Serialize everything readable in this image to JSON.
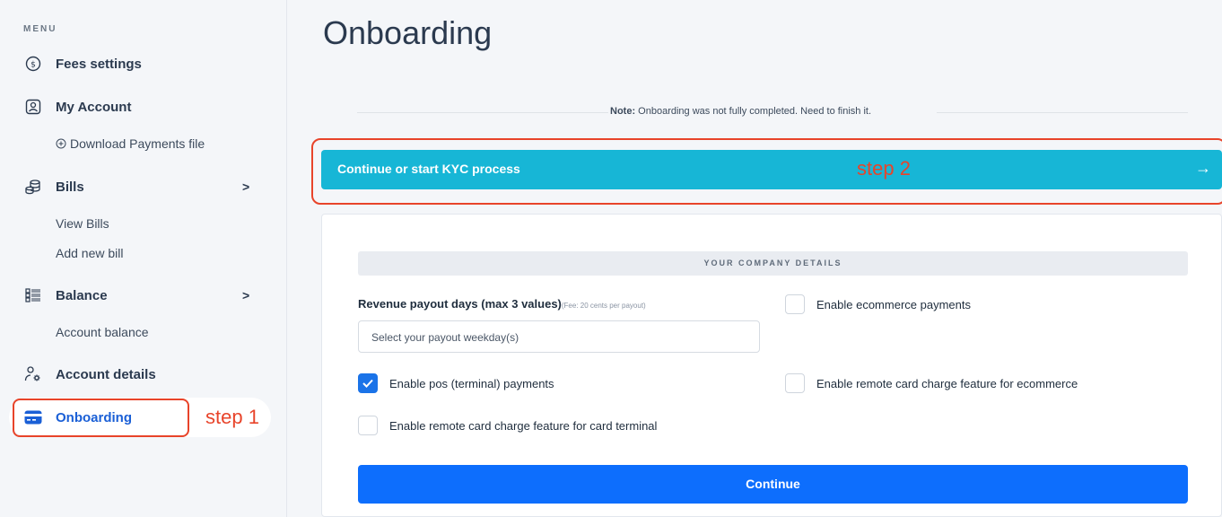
{
  "sidebar": {
    "menu_label": "MENU",
    "items": {
      "fees": {
        "label": "Fees settings",
        "icon": "dollar-circle-icon"
      },
      "my_account": {
        "label": "My Account",
        "icon": "user-box-icon"
      },
      "download": {
        "label": "Download Payments file",
        "icon": "plus-circle-icon"
      },
      "bills": {
        "label": "Bills",
        "icon": "coins-icon",
        "chevron": ">"
      },
      "view_bills": {
        "label": "View Bills"
      },
      "add_bill": {
        "label": "Add new bill"
      },
      "balance": {
        "label": "Balance",
        "icon": "list-icon",
        "chevron": ">"
      },
      "account_balance": {
        "label": "Account balance"
      },
      "account_details": {
        "label": "Account details",
        "icon": "user-gear-icon"
      },
      "onboarding": {
        "label": "Onboarding",
        "icon": "card-icon"
      }
    },
    "step1_annotation": "step 1"
  },
  "main": {
    "title": "Onboarding",
    "note_bold": "Note:",
    "note_text": " Onboarding was not fully completed. Need to finish it.",
    "kyc_label": "Continue or start KYC process",
    "kyc_arrow": "→",
    "step2_annotation": "step 2",
    "section_title": "YOUR COMPANY DETAILS",
    "payout_label": "Revenue payout days (max 3 values)",
    "payout_hint": "(Fee: 20 cents per payout)",
    "payout_placeholder": "Select your payout weekday(s)",
    "checkboxes": {
      "ecommerce": {
        "label": "Enable ecommerce payments",
        "checked": false
      },
      "pos": {
        "label": "Enable pos (terminal) payments",
        "checked": true
      },
      "remote_ecommerce": {
        "label": "Enable remote card charge feature for ecommerce",
        "checked": false
      },
      "remote_terminal": {
        "label": "Enable remote card charge feature for card terminal",
        "checked": false
      }
    },
    "continue_label": "Continue"
  },
  "colors": {
    "accent": "#0d6efd",
    "kyc_bar": "#17b6d6",
    "annotation": "#e8442a",
    "active_nav": "#1a5fd6"
  }
}
